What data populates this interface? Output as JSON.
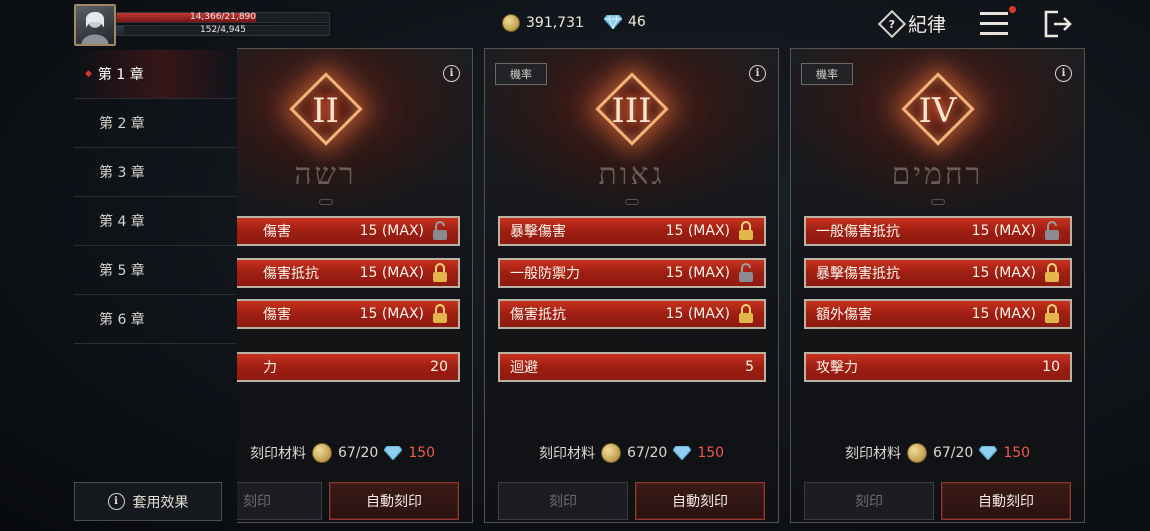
{
  "player": {
    "hp_text": "14,366/21,890",
    "hp_fraction": 0.656,
    "mp_text": "152/4,945",
    "mp_fraction": 0.031
  },
  "currency": {
    "gold": "391,731",
    "gems": "46"
  },
  "header": {
    "rules_label": "紀律"
  },
  "sidebar": {
    "chapters": [
      {
        "label": "第 1 章",
        "active": true
      },
      {
        "label": "第 2 章",
        "active": false
      },
      {
        "label": "第 3 章",
        "active": false
      },
      {
        "label": "第 4 章",
        "active": false
      },
      {
        "label": "第 5 章",
        "active": false
      },
      {
        "label": "第 6 章",
        "active": false
      }
    ],
    "apply_effect_label": "套用效果"
  },
  "cards": [
    {
      "numeral": "II",
      "rune_word": "רשה",
      "rate_label": "",
      "stats": [
        {
          "name": "傷害",
          "value": "15 (MAX)",
          "locked": false
        },
        {
          "name": "傷害抵抗",
          "value": "15 (MAX)",
          "locked": true
        },
        {
          "name": "傷害",
          "value": "15 (MAX)",
          "locked": true
        }
      ],
      "extra": {
        "name": "力",
        "value": "20"
      },
      "material_label": "刻印材料",
      "material_count": "67/20",
      "gem_cost": "150",
      "engrave_label": "刻印",
      "auto_label": "自動刻印"
    },
    {
      "numeral": "III",
      "rune_word": "גאות",
      "rate_label": "機率",
      "stats": [
        {
          "name": "暴擊傷害",
          "value": "15 (MAX)",
          "locked": true
        },
        {
          "name": "一般防禦力",
          "value": "15 (MAX)",
          "locked": false
        },
        {
          "name": "傷害抵抗",
          "value": "15 (MAX)",
          "locked": true
        }
      ],
      "extra": {
        "name": "迴避",
        "value": "5"
      },
      "material_label": "刻印材料",
      "material_count": "67/20",
      "gem_cost": "150",
      "engrave_label": "刻印",
      "auto_label": "自動刻印"
    },
    {
      "numeral": "IV",
      "rune_word": "רחמים",
      "rate_label": "機率",
      "stats": [
        {
          "name": "一般傷害抵抗",
          "value": "15 (MAX)",
          "locked": false
        },
        {
          "name": "暴擊傷害抵抗",
          "value": "15 (MAX)",
          "locked": true
        },
        {
          "name": "額外傷害",
          "value": "15 (MAX)",
          "locked": true
        }
      ],
      "extra": {
        "name": "攻擊力",
        "value": "10"
      },
      "material_label": "刻印材料",
      "material_count": "67/20",
      "gem_cost": "150",
      "engrave_label": "刻印",
      "auto_label": "自動刻印"
    }
  ],
  "icons": {
    "coin": "gold-coin-icon",
    "gem": "diamond-icon",
    "info": "info-icon",
    "lock_closed": "lock-icon",
    "lock_open": "unlock-icon",
    "menu": "hamburger-menu-icon",
    "exit": "exit-icon",
    "rules": "question-diamond-icon"
  },
  "colors": {
    "stat_red": "#b02818",
    "cost_red": "#ef5a4a",
    "gold": "#c9a24a",
    "notification": "#d63a2d"
  }
}
